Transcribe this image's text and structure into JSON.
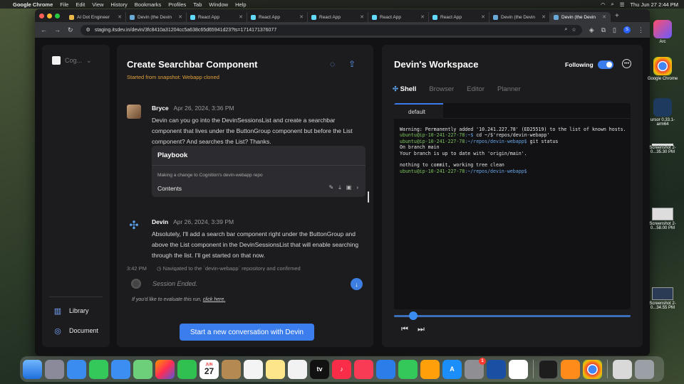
{
  "menubar": {
    "app": "Google Chrome",
    "items": [
      "File",
      "Edit",
      "View",
      "History",
      "Bookmarks",
      "Profiles",
      "Tab",
      "Window",
      "Help"
    ],
    "clock": "Thu Jun 27  2:44 PM"
  },
  "browser": {
    "tabs": [
      {
        "title": "AI Dot Engineer"
      },
      {
        "title": "Devin (the Devin"
      },
      {
        "title": "React App"
      },
      {
        "title": "React App"
      },
      {
        "title": "React App"
      },
      {
        "title": "React App"
      },
      {
        "title": "React App"
      },
      {
        "title": "Devin (the Devin"
      },
      {
        "title": "Devin (the Devin"
      }
    ],
    "url": "staging.itsdev.in/devin/3fc8410a31204cc5a638c65d65941d23?ts=1714171376077",
    "profile_initial": "S"
  },
  "leftnav": {
    "org_name": "Cog...",
    "items": [
      {
        "label": "Library",
        "icon": "library-icon"
      },
      {
        "label": "Document",
        "icon": "bulb-icon"
      }
    ]
  },
  "chat": {
    "title": "Create Searchbar Component",
    "subtitle": "Started from snapshot: Webapp cloned",
    "messages": [
      {
        "author": "Bryce",
        "time": "Apr 26, 2024, 3:36 PM",
        "text": "Devin can you go into the DevinSessionsList and create a searchbar component that lives under the ButtonGroup component but before the List component? And searches the List? Thanks."
      },
      {
        "author": "Devin",
        "time": "Apr 26, 2024, 3:39 PM",
        "text": "Absolutely, I'll add a search bar component right under the ButtonGroup and above the List component in the DevinSessionsList that will enable searching through the list. I'll get started on that now."
      }
    ],
    "playbook": {
      "title": "Playbook",
      "description": "Making a change to Cognition's devin-webapp repo",
      "contents_label": "Contents"
    },
    "step": {
      "time": "3:42 PM",
      "text": "Navigated to the `devin-webapp` repository and confirmed"
    },
    "input_placeholder": "Session Ended.",
    "eval_prefix": "If you'd like to evaluate this run, ",
    "eval_link": "click here.",
    "new_conversation_label": "Start a new conversation with Devin"
  },
  "workspace": {
    "title": "Devin's Workspace",
    "following_label": "Following",
    "following_on": true,
    "tabs": [
      "Shell",
      "Browser",
      "Editor",
      "Planner"
    ],
    "active_tab": "Shell",
    "terminal_tab": "default",
    "terminal_lines": [
      {
        "type": "text",
        "text": "Warning: Permanently added '10.241.227.78' (ED25519) to the list of known hosts."
      },
      {
        "type": "prompt",
        "user": "ubuntu@ip-10-241-227-78",
        "path": ":~$",
        "cmd": " cd ~/$'repos/devin-webapp'"
      },
      {
        "type": "prompt",
        "user": "ubuntu@ip-10-241-227-78",
        "path": ":~/repos/devin-webapp$",
        "cmd": " git status"
      },
      {
        "type": "text",
        "text": "On branch main"
      },
      {
        "type": "text",
        "text": "Your branch is up to date with 'origin/main'."
      },
      {
        "type": "text",
        "text": ""
      },
      {
        "type": "text",
        "text": "nothing to commit, working tree clean"
      },
      {
        "type": "prompt",
        "user": "ubuntu@ip-10-241-227-78",
        "path": ":~/repos/devin-webapp$",
        "cmd": ""
      }
    ],
    "playback_progress": 0.08
  },
  "desktop": {
    "items": [
      {
        "label": "Arc",
        "kind": "app"
      },
      {
        "label": "Google Chrome",
        "kind": "app"
      },
      {
        "label": "ursor 0.33.1-arm64",
        "kind": "app"
      },
      {
        "label": "Screenshot 2-0...35.30 PM",
        "kind": "thumb"
      },
      {
        "label": "Screenshot 2-0...58.00 PM",
        "kind": "thumb"
      },
      {
        "label": "Screenshot 2-0...34.55 PM",
        "kind": "thumb"
      }
    ]
  },
  "dock": {
    "calendar_day": "27",
    "calendar_month": "JUN",
    "appstore_badge": "1"
  }
}
